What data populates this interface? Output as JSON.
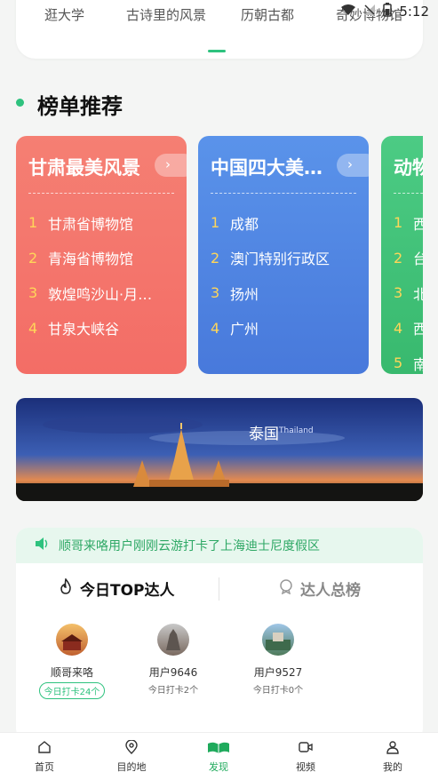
{
  "status_bar": {
    "time": "5:12"
  },
  "top_tabs": [
    {
      "label": "逛大学"
    },
    {
      "label": "古诗里的风景"
    },
    {
      "label": "历朝古都"
    },
    {
      "label": "奇妙博物馆"
    }
  ],
  "section": {
    "title": "榜单推荐"
  },
  "rank_cards": [
    {
      "title": "甘肃最美风景",
      "items": [
        "甘肃省博物馆",
        "青海省博物馆",
        "敦煌鸣沙山·月…",
        "甘泉大峡谷"
      ]
    },
    {
      "title": "中国四大美…",
      "items": [
        "成都",
        "澳门特别行政区",
        "扬州",
        "广州"
      ]
    },
    {
      "title": "动物",
      "items": [
        "西",
        "台",
        "北",
        "西",
        "南"
      ]
    }
  ],
  "banner": {
    "text_main": "泰国",
    "text_en": "Thailand"
  },
  "notice": {
    "text": "顺哥来咯用户刚刚云游打卡了上海迪士尼度假区"
  },
  "segments": {
    "left": "今日TOP达人",
    "right": "达人总榜"
  },
  "users": [
    {
      "name": "顺哥来咯",
      "count": "今日打卡24个"
    },
    {
      "name": "用户9646",
      "count": "今日打卡2个"
    },
    {
      "name": "用户9527",
      "count": "今日打卡0个"
    }
  ],
  "nav": [
    {
      "label": "首页"
    },
    {
      "label": "目的地"
    },
    {
      "label": "发现"
    },
    {
      "label": "视频"
    },
    {
      "label": "我的"
    }
  ],
  "colors": {
    "accent": "#2ec27e",
    "card_red": "#f26b60",
    "card_blue": "#4b86e0",
    "card_green": "#3fc47a"
  }
}
